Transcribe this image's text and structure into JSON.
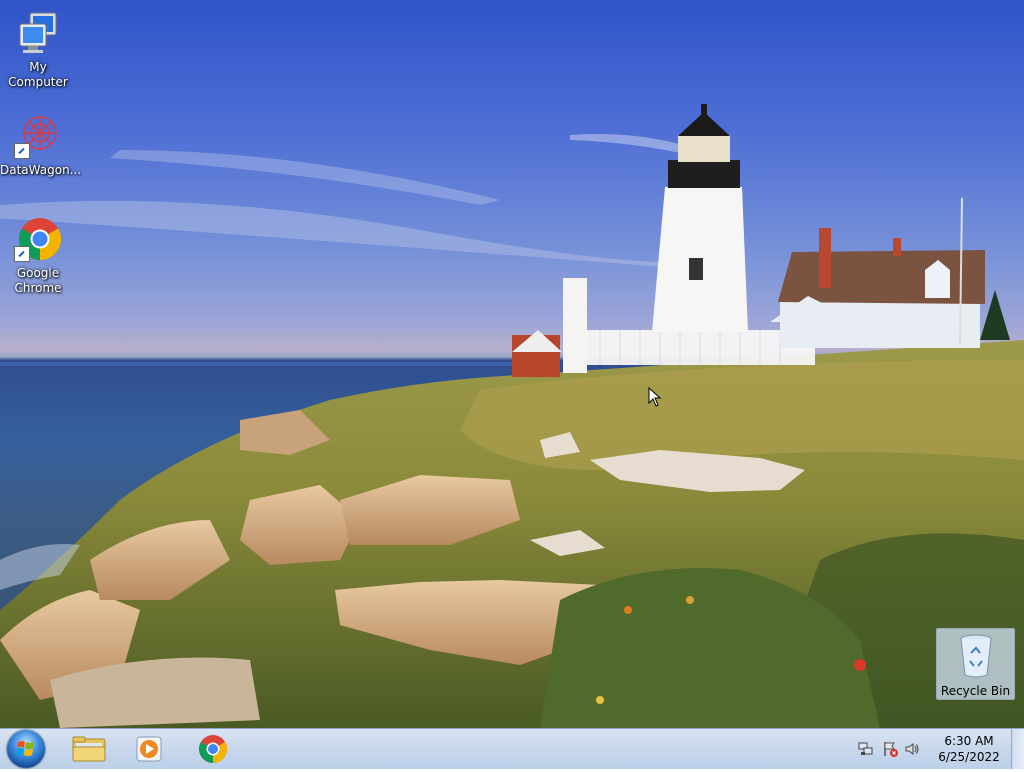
{
  "desktop_icons": [
    {
      "label": "My Computer",
      "icon": "computer-icon"
    },
    {
      "label": "DataWagon...",
      "icon": "datawagon-icon"
    },
    {
      "label": "Google Chrome",
      "icon": "chrome-icon"
    },
    {
      "label": "Recycle Bin",
      "icon": "recycle-bin-icon"
    }
  ],
  "taskbar": {
    "pinned": [
      {
        "name": "windows-explorer",
        "icon": "folder-icon"
      },
      {
        "name": "media-player",
        "icon": "media-player-icon"
      },
      {
        "name": "google-chrome",
        "icon": "chrome-icon"
      }
    ],
    "clock": {
      "time": "6:30 AM",
      "date": "6/25/2022"
    }
  }
}
